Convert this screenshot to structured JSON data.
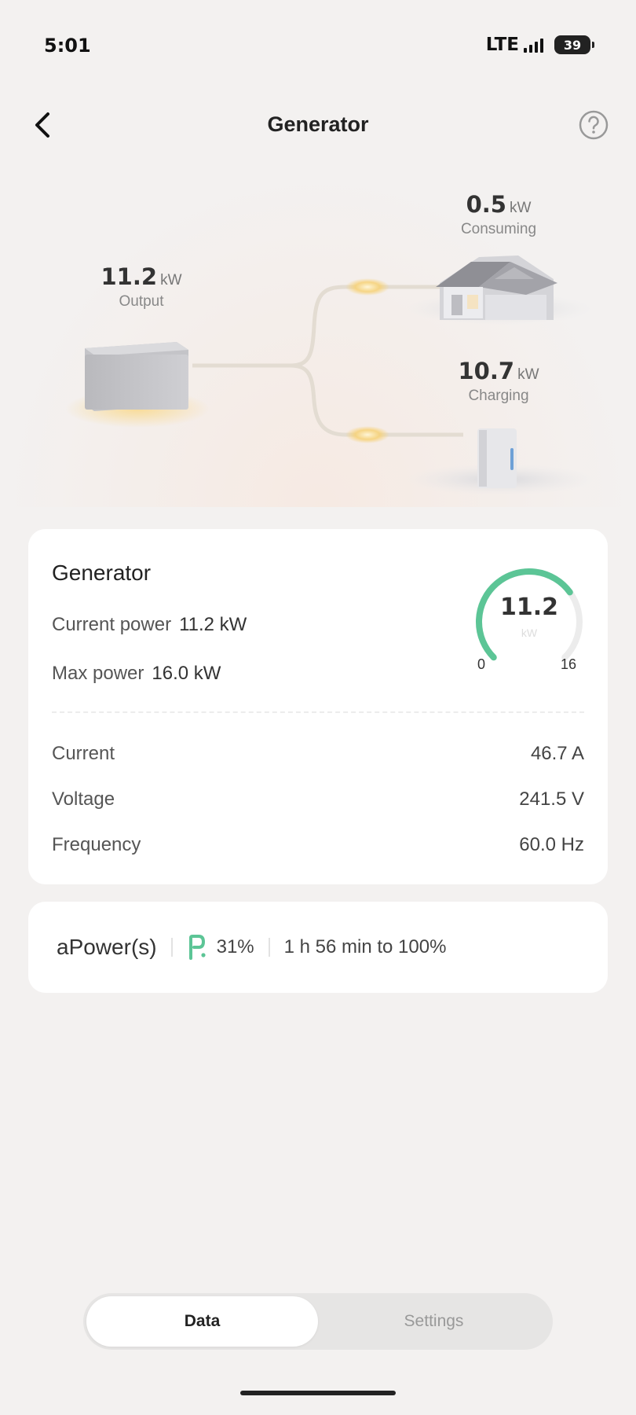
{
  "status_bar": {
    "time": "5:01",
    "network": "LTE",
    "battery": "39"
  },
  "nav": {
    "title": "Generator",
    "back_icon": "chevron-left-icon",
    "help_icon": "question-circle-icon"
  },
  "flow": {
    "output": {
      "value": "11.2",
      "unit": "kW",
      "caption": "Output"
    },
    "consuming": {
      "value": "0.5",
      "unit": "kW",
      "caption": "Consuming"
    },
    "charging": {
      "value": "10.7",
      "unit": "kW",
      "caption": "Charging"
    }
  },
  "generator_card": {
    "title": "Generator",
    "current_power_label": "Current power",
    "current_power_value": "11.2 kW",
    "max_power_label": "Max power",
    "max_power_value": "16.0 kW",
    "gauge": {
      "value": "11.2",
      "unit": "kW",
      "min": "0",
      "max": "16",
      "level": 0.7
    },
    "rows": [
      {
        "label": "Current",
        "value": "46.7 A"
      },
      {
        "label": "Voltage",
        "value": "241.5 V"
      },
      {
        "label": "Frequency",
        "value": "60.0 Hz"
      }
    ]
  },
  "apower_card": {
    "name": "aPower(s)",
    "percent": "31%",
    "eta": "1 h 56 min to 100%",
    "icon": "battery-charging-icon"
  },
  "tabs": [
    {
      "label": "Data",
      "active": true
    },
    {
      "label": "Settings",
      "active": false
    }
  ],
  "colors": {
    "accent_green": "#5cc596",
    "glow": "#f6d27a",
    "background": "#f3f1f0"
  }
}
